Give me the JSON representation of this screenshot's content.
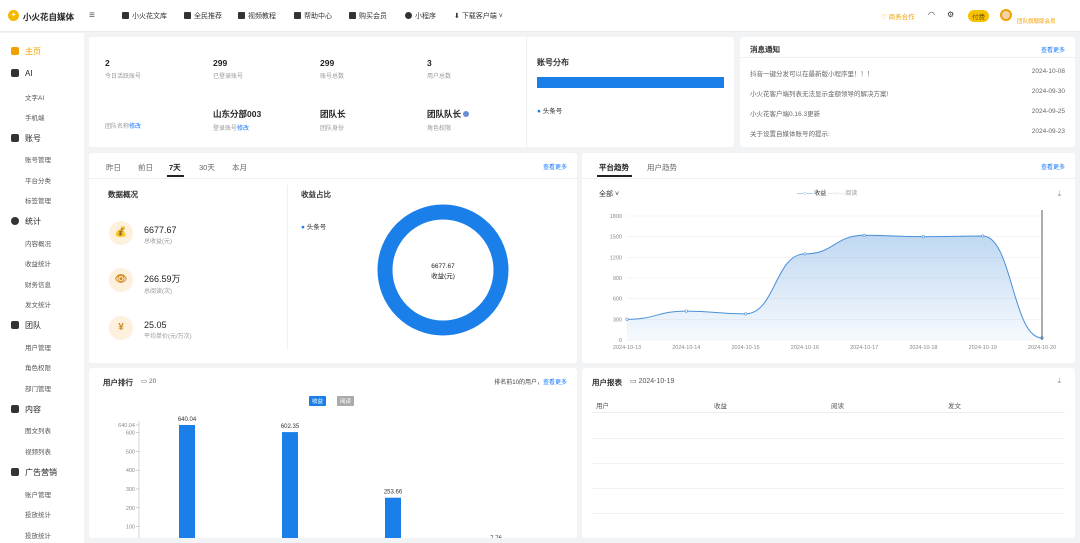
{
  "brand": "小火花自媒体",
  "topnav": [
    {
      "label": "小火花文库",
      "icon": "book-icon"
    },
    {
      "label": "全民推荐",
      "icon": "bag-icon"
    },
    {
      "label": "视频教程",
      "icon": "video-icon"
    },
    {
      "label": "帮助中心",
      "icon": "help-book-icon"
    },
    {
      "label": "购买会员",
      "icon": "diamond-icon"
    },
    {
      "label": "小程序",
      "icon": "mini-program-icon"
    },
    {
      "label": "下载客户端",
      "icon": "download-icon"
    }
  ],
  "topright": {
    "cooperate": "商务合作",
    "vip": "付费",
    "team": "团队旗舰版会员"
  },
  "sidebar": [
    {
      "label": "主页",
      "icon": "home-icon",
      "active": true,
      "items": []
    },
    {
      "label": "AI",
      "icon": "ai-icon",
      "items": [
        "文字AI",
        "手机端"
      ]
    },
    {
      "label": "账号",
      "icon": "account-icon",
      "items": [
        "账号管理",
        "平台分类",
        "标签管理"
      ]
    },
    {
      "label": "统计",
      "icon": "pie-icon",
      "items": [
        "内容概况",
        "收益统计",
        "财务信息",
        "发文统计"
      ]
    },
    {
      "label": "团队",
      "icon": "team-icon",
      "items": [
        "用户管理",
        "角色权限",
        "部门管理"
      ]
    },
    {
      "label": "内容",
      "icon": "content-icon",
      "items": [
        "图文列表",
        "视频列表"
      ]
    },
    {
      "label": "广告营销",
      "icon": "ad-icon",
      "items": [
        "账户管理",
        "投放统计",
        "投放统计"
      ]
    }
  ],
  "stats": [
    {
      "value": "2",
      "label": "今日活跃账号"
    },
    {
      "value": "299",
      "label": "已登录账号"
    },
    {
      "value": "299",
      "label": "账号总数"
    },
    {
      "value": "3",
      "label": "用户总数"
    }
  ],
  "stats2": [
    {
      "value": "",
      "label": "团队名称",
      "link": "修改"
    },
    {
      "value": "山东分部003",
      "label": "登录账号",
      "link": "修改"
    },
    {
      "value": "团队长",
      "label": "团队身份",
      "link": ""
    },
    {
      "value": "团队队长",
      "label": "角色权限",
      "link": ""
    }
  ],
  "account_dist": {
    "title": "账号分布",
    "legend": "头条号",
    "color": "#1a7fe8"
  },
  "notice": {
    "title": "消息通知",
    "more": "查看更多",
    "items": [
      {
        "text": "抖音一键分发可以在最新版小程序里！！！",
        "date": "2024-10-08"
      },
      {
        "text": "小火花客户端列表无法显示金额领导的解决方案!",
        "date": "2024-09-30"
      },
      {
        "text": "小火花客户端0.16.3更新",
        "date": "2024-09-25"
      },
      {
        "text": "关于设置自媒体账号的提示:",
        "date": "2024-09-23"
      }
    ]
  },
  "overview": {
    "tabs": [
      "昨日",
      "前日",
      "7天",
      "30天",
      "本月"
    ],
    "active_tab": "7天",
    "more": "查看更多",
    "title": "数据概况",
    "items": [
      {
        "value": "6677.67",
        "label": "总收益(元)",
        "icon": "money-bag-icon",
        "glyph": "💰"
      },
      {
        "value": "266.59万",
        "label": "总阅读(次)",
        "icon": "eye-icon",
        "glyph": "👁"
      },
      {
        "value": "25.05",
        "label": "平均单价(元/万次)",
        "icon": "yen-icon",
        "glyph": "¥"
      }
    ],
    "income_title": "收益占比",
    "income_legend": "头条号",
    "donut_value": "6677.67",
    "donut_label": "收益(元)"
  },
  "trend": {
    "tabs": [
      "平台趋势",
      "用户趋势"
    ],
    "more": "查看更多",
    "filter": "全部",
    "legend": [
      "收益",
      "阅读"
    ]
  },
  "ranking": {
    "title": "用户排行",
    "date_prefix": "20",
    "note": "排名前10的用户，",
    "more": "查看更多",
    "toggles": [
      "收益",
      "阅读"
    ]
  },
  "report": {
    "title": "用户报表",
    "date": "2024-10-19",
    "columns": [
      "用户",
      "收益",
      "阅读",
      "发文"
    ]
  },
  "chart_data": [
    {
      "type": "area",
      "x": [
        "2024-10-13",
        "2024-10-14",
        "2024-10-15",
        "2024-10-16",
        "2024-10-17",
        "2024-10-18",
        "2024-10-19",
        "2024-10-20"
      ],
      "series": [
        {
          "name": "收益",
          "values": [
            300,
            420,
            380,
            1250,
            1520,
            1500,
            1510,
            30
          ]
        }
      ],
      "ylim": [
        0,
        1800
      ],
      "yticks": [
        0,
        300,
        600,
        900,
        1200,
        1500,
        1800
      ],
      "color": "#4a90d9"
    },
    {
      "type": "bar",
      "values": [
        640.04,
        602.35,
        253.66,
        7.76
      ],
      "yticks_labels": [
        "7.76",
        "100",
        "200",
        "300",
        "400",
        "500",
        "600",
        "640.04"
      ],
      "yticks": [
        7.76,
        100,
        200,
        300,
        400,
        500,
        600,
        640.04
      ],
      "color": "#1a7fe8"
    }
  ]
}
